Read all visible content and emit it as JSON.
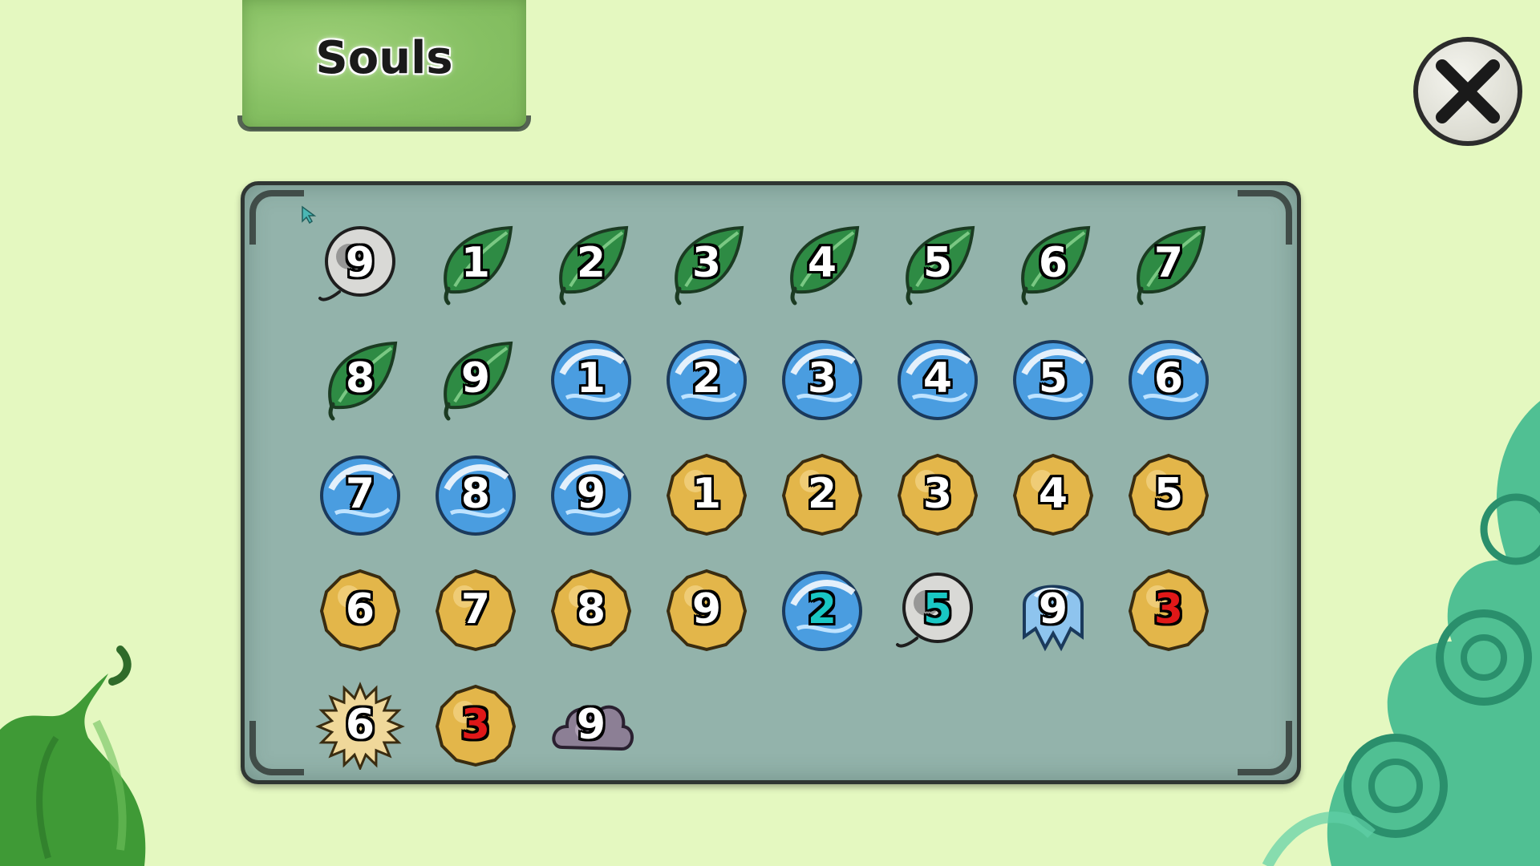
{
  "title": "Souls",
  "close": {
    "icon": "close-x-icon"
  },
  "colors": {
    "background": "#e4f8c0",
    "panel": "#93b3ab",
    "title_tab": "#86c063",
    "number_default": "#ffffff",
    "number_red": "#e01818",
    "number_teal": "#19c7c4"
  },
  "souls": [
    {
      "type": "smoke",
      "number": "9",
      "color": "#ffffff"
    },
    {
      "type": "leaf",
      "number": "1",
      "color": "#ffffff"
    },
    {
      "type": "leaf",
      "number": "2",
      "color": "#ffffff"
    },
    {
      "type": "leaf",
      "number": "3",
      "color": "#ffffff"
    },
    {
      "type": "leaf",
      "number": "4",
      "color": "#ffffff"
    },
    {
      "type": "leaf",
      "number": "5",
      "color": "#ffffff"
    },
    {
      "type": "leaf",
      "number": "6",
      "color": "#ffffff"
    },
    {
      "type": "leaf",
      "number": "7",
      "color": "#ffffff"
    },
    {
      "type": "leaf",
      "number": "8",
      "color": "#ffffff"
    },
    {
      "type": "leaf",
      "number": "9",
      "color": "#ffffff"
    },
    {
      "type": "wave",
      "number": "1",
      "color": "#ffffff"
    },
    {
      "type": "wave",
      "number": "2",
      "color": "#ffffff"
    },
    {
      "type": "wave",
      "number": "3",
      "color": "#ffffff"
    },
    {
      "type": "wave",
      "number": "4",
      "color": "#ffffff"
    },
    {
      "type": "wave",
      "number": "5",
      "color": "#ffffff"
    },
    {
      "type": "wave",
      "number": "6",
      "color": "#ffffff"
    },
    {
      "type": "wave",
      "number": "7",
      "color": "#ffffff"
    },
    {
      "type": "wave",
      "number": "8",
      "color": "#ffffff"
    },
    {
      "type": "wave",
      "number": "9",
      "color": "#ffffff"
    },
    {
      "type": "gold",
      "number": "1",
      "color": "#ffffff"
    },
    {
      "type": "gold",
      "number": "2",
      "color": "#ffffff"
    },
    {
      "type": "gold",
      "number": "3",
      "color": "#ffffff"
    },
    {
      "type": "gold",
      "number": "4",
      "color": "#ffffff"
    },
    {
      "type": "gold",
      "number": "5",
      "color": "#ffffff"
    },
    {
      "type": "gold",
      "number": "6",
      "color": "#ffffff"
    },
    {
      "type": "gold",
      "number": "7",
      "color": "#ffffff"
    },
    {
      "type": "gold",
      "number": "8",
      "color": "#ffffff"
    },
    {
      "type": "gold",
      "number": "9",
      "color": "#ffffff"
    },
    {
      "type": "wave",
      "number": "2",
      "color": "#19c7c4"
    },
    {
      "type": "smoke",
      "number": "5",
      "color": "#19c7c4"
    },
    {
      "type": "ghost",
      "number": "9",
      "color": "#ffffff"
    },
    {
      "type": "gold",
      "number": "3",
      "color": "#e01818"
    },
    {
      "type": "sun",
      "number": "6",
      "color": "#ffffff"
    },
    {
      "type": "gold",
      "number": "3",
      "color": "#e01818"
    },
    {
      "type": "cloud",
      "number": "9",
      "color": "#ffffff"
    }
  ]
}
